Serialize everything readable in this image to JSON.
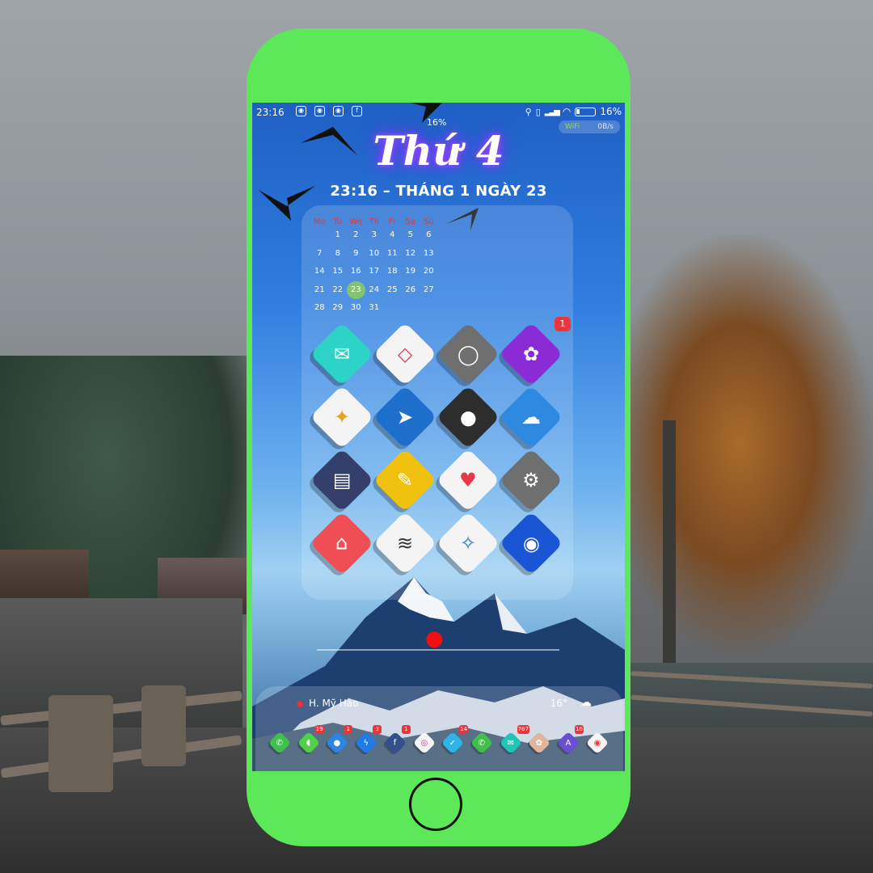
{
  "status_bar": {
    "time": "23:16",
    "battery_percent": "16%",
    "data_speed": "0B/s",
    "wifi_label": "WiFi",
    "battery_top": "16%",
    "left_icons": [
      "message-icon",
      "message-icon",
      "message-icon",
      "message-icon",
      "facebook-icon"
    ],
    "left_glyphs": [
      "◉",
      "◉",
      "◉",
      "◉",
      "f"
    ]
  },
  "lock": {
    "day_title": "Thứ 4",
    "date_line": "23:16 – THÁNG 1 NGÀY 23"
  },
  "calendar": {
    "weekdays": [
      "Mo",
      "Tu",
      "We",
      "Th",
      "Fr",
      "Sa",
      "Su"
    ],
    "weeks": [
      [
        "",
        "1",
        "2",
        "3",
        "4",
        "5",
        "6"
      ],
      [
        "7",
        "8",
        "9",
        "10",
        "11",
        "12",
        "13"
      ],
      [
        "14",
        "15",
        "16",
        "17",
        "18",
        "19",
        "20"
      ],
      [
        "21",
        "22",
        "23",
        "24",
        "25",
        "26",
        "27"
      ],
      [
        "28",
        "29",
        "30",
        "31",
        "",
        "",
        ""
      ]
    ],
    "today": "23"
  },
  "apps": [
    {
      "name": "mail-app",
      "glyph": "✉",
      "color": "#2cd3c6"
    },
    {
      "name": "diamond-app",
      "glyph": "◇",
      "color": "#f4f4f4",
      "glyph_color": "#e03a55"
    },
    {
      "name": "camera-app",
      "glyph": "◯",
      "color": "#6f6f6f"
    },
    {
      "name": "flower-app",
      "glyph": "✿",
      "color": "#8b2bd6",
      "badge": "1"
    },
    {
      "name": "pinwheel-app",
      "glyph": "✦",
      "color": "#f4f4f4",
      "glyph_color": "#e8a020"
    },
    {
      "name": "navigation-app",
      "glyph": "➤",
      "color": "#1d6fcb"
    },
    {
      "name": "record-app",
      "glyph": "●",
      "color": "#2d2d2d"
    },
    {
      "name": "cloud-app",
      "glyph": "☁",
      "color": "#2e8ae0"
    },
    {
      "name": "wallet-app",
      "glyph": "▤",
      "color": "#34406b"
    },
    {
      "name": "notes-app",
      "glyph": "✎",
      "color": "#f0c20f"
    },
    {
      "name": "health-app",
      "glyph": "♥",
      "color": "#f4f4f4",
      "glyph_color": "#e63a4a"
    },
    {
      "name": "settings-app",
      "glyph": "⚙",
      "color": "#6f6f6f"
    },
    {
      "name": "airbnb-app",
      "glyph": "⌂",
      "color": "#ef4e54"
    },
    {
      "name": "soundwave-app",
      "glyph": "≋",
      "color": "#f4f4f4",
      "glyph_color": "#333"
    },
    {
      "name": "safari-app",
      "glyph": "✧",
      "color": "#f4f4f4",
      "glyph_color": "#2a6fdb"
    },
    {
      "name": "balloon-app",
      "glyph": "◉",
      "color": "#1a55d6"
    }
  ],
  "weather": {
    "location": "H. Mỹ Hào",
    "temperature": "16°"
  },
  "dock": [
    {
      "name": "phone-app",
      "glyph": "✆",
      "color": "#3cc24a"
    },
    {
      "name": "messages-app",
      "glyph": "◖",
      "color": "#4fd14a",
      "badge": "19"
    },
    {
      "name": "chat-app",
      "glyph": "●",
      "color": "#2b85e6",
      "badge": "1"
    },
    {
      "name": "messenger-app",
      "glyph": "ϟ",
      "color": "#1e7be8",
      "badge": "3"
    },
    {
      "name": "facebook-app",
      "glyph": "f",
      "color": "#334f8d",
      "badge": "1"
    },
    {
      "name": "instagram-app",
      "glyph": "◎",
      "color": "#f4f4f4",
      "glyph_color": "#c13584"
    },
    {
      "name": "twitter-app",
      "glyph": "✓",
      "color": "#2fb4e8",
      "badge": "14"
    },
    {
      "name": "whatsapp-app",
      "glyph": "✆",
      "color": "#40c04a"
    },
    {
      "name": "mail2-app",
      "glyph": "✉",
      "color": "#1ec7b5",
      "badge": "767"
    },
    {
      "name": "photos-app",
      "glyph": "✿",
      "color": "#e0b59a"
    },
    {
      "name": "appstore-app",
      "glyph": "A",
      "color": "#6a4fd6",
      "badge": "16"
    },
    {
      "name": "chrome-app",
      "glyph": "◉",
      "color": "#f4f4f4",
      "glyph_color": "#e03a3a"
    }
  ]
}
